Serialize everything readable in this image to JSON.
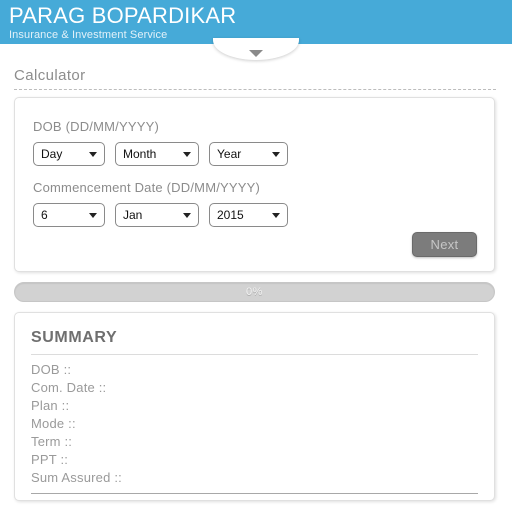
{
  "header": {
    "title": "PARAG BOPARDIKAR",
    "subtitle": "Insurance & Investment Service",
    "background_color": "#46aad8",
    "title_color": "#ffffff",
    "pull_tab_icon": "chevron-down-icon"
  },
  "section": {
    "title": "Calculator"
  },
  "form": {
    "dob_label": "DOB (DD/MM/YYYY)",
    "dob": {
      "day": {
        "value": "Day",
        "caret": "caret-down-icon"
      },
      "month": {
        "value": "Month",
        "caret": "caret-down-icon"
      },
      "year": {
        "value": "Year",
        "caret": "caret-down-icon"
      }
    },
    "commencement_label": "Commencement Date (DD/MM/YYYY)",
    "commencement": {
      "day": {
        "value": "6",
        "caret": "caret-down-icon"
      },
      "month": {
        "value": "Jan",
        "caret": "caret-down-icon"
      },
      "year": {
        "value": "2015",
        "caret": "caret-down-icon"
      }
    },
    "next_label": "Next"
  },
  "progress": {
    "label": "0%",
    "percent": 0,
    "track_color": "#d2d2d2"
  },
  "summary": {
    "title": "SUMMARY",
    "rows": [
      {
        "label": "DOB ::"
      },
      {
        "label": "Com. Date ::"
      },
      {
        "label": "Plan ::"
      },
      {
        "label": "Mode ::"
      },
      {
        "label": "Term ::"
      },
      {
        "label": "PPT ::"
      },
      {
        "label": "Sum Assured ::"
      }
    ]
  }
}
